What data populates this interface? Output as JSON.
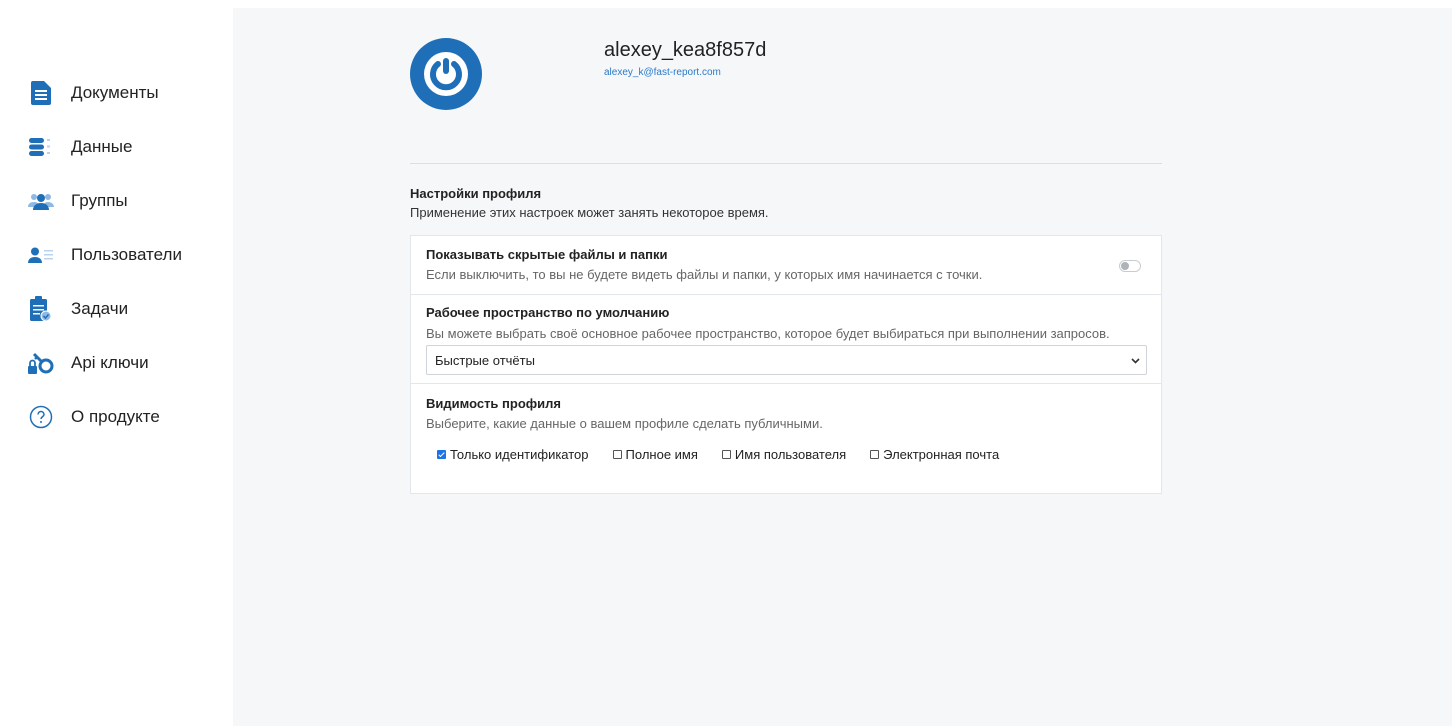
{
  "sidebar": {
    "items": [
      {
        "label": "Документы",
        "icon": "document-icon"
      },
      {
        "label": "Данные",
        "icon": "database-icon"
      },
      {
        "label": "Группы",
        "icon": "group-icon"
      },
      {
        "label": "Пользователи",
        "icon": "users-icon"
      },
      {
        "label": "Задачи",
        "icon": "tasks-icon"
      },
      {
        "label": "Api ключи",
        "icon": "api-key-icon"
      },
      {
        "label": "О продукте",
        "icon": "help-icon"
      }
    ]
  },
  "profile": {
    "username": "alexey_kea8f857d",
    "email": "alexey_k@fast-report.com",
    "avatar_icon": "power-icon"
  },
  "settings": {
    "title": "Настройки профиля",
    "description": "Применение этих настроек может занять некоторое время.",
    "hidden_files": {
      "title": "Показывать скрытые файлы и папки",
      "description": "Если выключить, то вы не будете видеть файлы и папки, у которых имя начинается с точки.",
      "enabled": false
    },
    "workspace": {
      "title": "Рабочее пространство по умолчанию",
      "description": "Вы можете выбрать своё основное рабочее пространство, которое будет выбираться при выполнении запросов.",
      "selected": "Быстрые отчёты"
    },
    "visibility": {
      "title": "Видимость профиля",
      "description": "Выберите, какие данные о вашем профиле сделать публичными.",
      "options": [
        {
          "label": "Только идентификатор",
          "checked": true
        },
        {
          "label": "Полное имя",
          "checked": false
        },
        {
          "label": "Имя пользователя",
          "checked": false
        },
        {
          "label": "Электронная почта",
          "checked": false
        }
      ]
    }
  },
  "colors": {
    "accent": "#1f6fb8",
    "background": "#f6f7f9",
    "link": "#2a7ac9"
  }
}
